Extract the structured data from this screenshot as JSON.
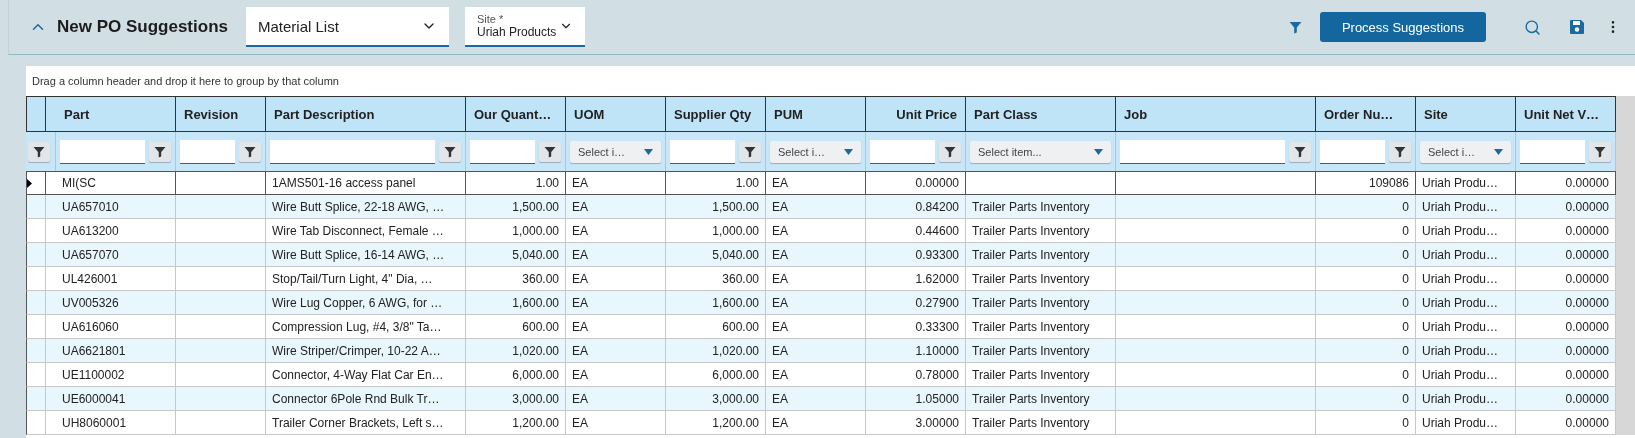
{
  "header": {
    "title": "New PO Suggestions",
    "collapsed": false,
    "view_select": {
      "value": "Material List"
    },
    "site_select": {
      "label": "Site *",
      "value": "Uriah Products"
    },
    "process_button": "Process Suggestions"
  },
  "grid": {
    "group_hint": "Drag a column header and drop it here to group by that column",
    "columns": [
      {
        "label": "Part",
        "filter": {
          "kind": "text"
        }
      },
      {
        "label": "Revision",
        "filter": {
          "kind": "text"
        }
      },
      {
        "label": "Part Description",
        "filter": {
          "kind": "text"
        }
      },
      {
        "label": "Our Quant…",
        "filter": {
          "kind": "text"
        }
      },
      {
        "label": "UOM",
        "filter": {
          "kind": "select",
          "placeholder": "Select i…"
        }
      },
      {
        "label": "Supplier Qty",
        "filter": {
          "kind": "text"
        }
      },
      {
        "label": "PUM",
        "filter": {
          "kind": "select",
          "placeholder": "Select i…"
        }
      },
      {
        "label": "Unit Price",
        "filter": {
          "kind": "text"
        }
      },
      {
        "label": "Part Class",
        "filter": {
          "kind": "select",
          "placeholder": "Select item..."
        }
      },
      {
        "label": "Job",
        "filter": {
          "kind": "text"
        }
      },
      {
        "label": "Order Nu…",
        "filter": {
          "kind": "text"
        }
      },
      {
        "label": "Site",
        "filter": {
          "kind": "select",
          "placeholder": "Select i…"
        }
      },
      {
        "label": "Unit Net V…",
        "filter": {
          "kind": "text"
        }
      }
    ],
    "rows": [
      {
        "current": true,
        "cells": [
          "MI(SC",
          null,
          "1AMS501-16 access panel",
          "1.00",
          "EA",
          "1.00",
          "EA",
          "0.00000",
          null,
          null,
          "109086",
          "Uriah Produ…",
          "0.00000"
        ]
      },
      {
        "current": false,
        "cells": [
          "UA657010",
          null,
          "Wire Butt Splice, 22-18 AWG, …",
          "1,500.00",
          "EA",
          "1,500.00",
          "EA",
          "0.84200",
          "Trailer Parts Inventory",
          null,
          "0",
          "Uriah Produ…",
          "0.00000"
        ]
      },
      {
        "current": false,
        "cells": [
          "UA613200",
          null,
          "Wire Tab Disconnect, Female …",
          "1,000.00",
          "EA",
          "1,000.00",
          "EA",
          "0.44600",
          "Trailer Parts Inventory",
          null,
          "0",
          "Uriah Produ…",
          "0.00000"
        ]
      },
      {
        "current": false,
        "cells": [
          "UA657070",
          null,
          "Wire Butt Splice, 16-14 AWG, …",
          "5,040.00",
          "EA",
          "5,040.00",
          "EA",
          "0.93300",
          "Trailer Parts Inventory",
          null,
          "0",
          "Uriah Produ…",
          "0.00000"
        ]
      },
      {
        "current": false,
        "cells": [
          "UL426001",
          null,
          "Stop/Tail/Turn Light, 4\" Dia, …",
          "360.00",
          "EA",
          "360.00",
          "EA",
          "1.62000",
          "Trailer Parts Inventory",
          null,
          "0",
          "Uriah Produ…",
          "0.00000"
        ]
      },
      {
        "current": false,
        "cells": [
          "UV005326",
          null,
          "Wire Lug Copper, 6 AWG, for …",
          "1,600.00",
          "EA",
          "1,600.00",
          "EA",
          "0.27900",
          "Trailer Parts Inventory",
          null,
          "0",
          "Uriah Produ…",
          "0.00000"
        ]
      },
      {
        "current": false,
        "cells": [
          "UA616060",
          null,
          "Compression Lug, #4, 3/8\" Ta…",
          "600.00",
          "EA",
          "600.00",
          "EA",
          "0.33300",
          "Trailer Parts Inventory",
          null,
          "0",
          "Uriah Produ…",
          "0.00000"
        ]
      },
      {
        "current": false,
        "cells": [
          "UA6621801",
          null,
          "Wire Striper/Crimper, 10-22 A…",
          "1,020.00",
          "EA",
          "1,020.00",
          "EA",
          "1.10000",
          "Trailer Parts Inventory",
          null,
          "0",
          "Uriah Produ…",
          "0.00000"
        ]
      },
      {
        "current": false,
        "cells": [
          "UE1100002",
          null,
          "Connector, 4-Way Flat Car En…",
          "6,000.00",
          "EA",
          "6,000.00",
          "EA",
          "0.78000",
          "Trailer Parts Inventory",
          null,
          "0",
          "Uriah Produ…",
          "0.00000"
        ]
      },
      {
        "current": false,
        "cells": [
          "UE6000041",
          null,
          "Connector 6Pole Rnd Bulk Tr…",
          "3,000.00",
          "EA",
          "3,000.00",
          "EA",
          "1.05000",
          "Trailer Parts Inventory",
          null,
          "0",
          "Uriah Produ…",
          "0.00000"
        ]
      },
      {
        "current": false,
        "cells": [
          "UH8060001",
          null,
          "Trailer Corner Brackets, Left s…",
          "1,200.00",
          "EA",
          "1,200.00",
          "EA",
          "3.00000",
          "Trailer Parts Inventory",
          null,
          "0",
          "Uriah Produ…",
          "0.00000"
        ]
      }
    ]
  }
}
